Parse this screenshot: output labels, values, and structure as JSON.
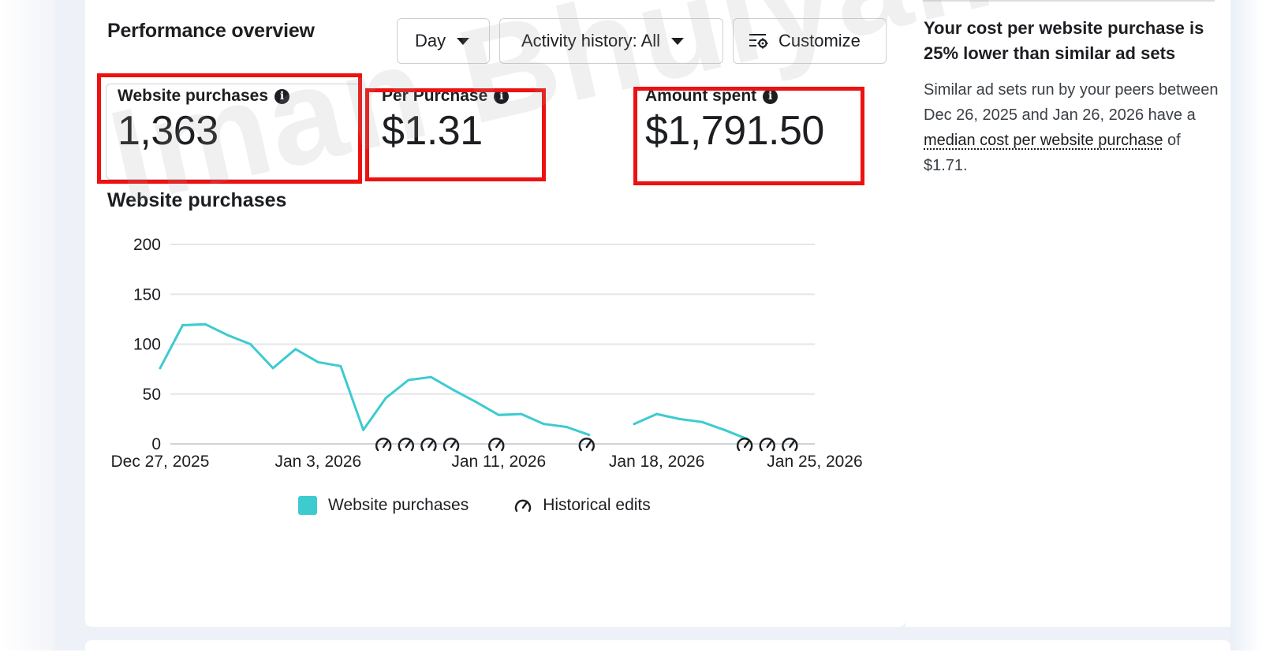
{
  "header": {
    "title": "Performance overview",
    "period_button": "Day",
    "activity_button": "Activity history: All",
    "customize_button": "Customize"
  },
  "metrics": [
    {
      "label": "Website purchases",
      "value": "1,363"
    },
    {
      "label": "Per Purchase",
      "value": "$1.31"
    },
    {
      "label": "Amount spent",
      "value": "$1,791.50"
    }
  ],
  "chart_title": "Website purchases",
  "chart_data": {
    "type": "line",
    "series": [
      {
        "name": "Website purchases",
        "color": "#3dcbd0"
      }
    ],
    "x_tick_labels": [
      "Dec 27, 2025",
      "Jan 3, 2026",
      "Jan 11, 2026",
      "Jan 18, 2026",
      "Jan 25, 2026"
    ],
    "x_tick_positions": [
      0,
      7,
      15,
      22,
      29
    ],
    "y_ticks": [
      0,
      50,
      100,
      150,
      200
    ],
    "ylim": [
      0,
      200
    ],
    "xlim": [
      -2.2,
      29.0
    ],
    "points": [
      {
        "day": 0,
        "value": 76
      },
      {
        "day": 1,
        "value": 119
      },
      {
        "day": 2,
        "value": 120
      },
      {
        "day": 3,
        "value": 109
      },
      {
        "day": 4,
        "value": 100
      },
      {
        "day": 5,
        "value": 76
      },
      {
        "day": 6,
        "value": 95
      },
      {
        "day": 7,
        "value": 82
      },
      {
        "day": 8,
        "value": 78
      },
      {
        "day": 9,
        "value": 14
      },
      {
        "day": 10,
        "value": 46
      },
      {
        "day": 11,
        "value": 64
      },
      {
        "day": 12,
        "value": 67
      },
      {
        "day": 13,
        "value": 54
      },
      {
        "day": 14,
        "value": 42
      },
      {
        "day": 15,
        "value": 29
      },
      {
        "day": 16,
        "value": 30
      },
      {
        "day": 17,
        "value": 20
      },
      {
        "day": 18,
        "value": 17
      },
      {
        "day": 19,
        "value": 9
      },
      {
        "day": 21,
        "value": 20
      },
      {
        "day": 22,
        "value": 30
      },
      {
        "day": 23,
        "value": 25
      },
      {
        "day": 24,
        "value": 22
      },
      {
        "day": 25,
        "value": 14
      },
      {
        "day": 26,
        "value": 5
      }
    ],
    "historical_edit_days": [
      10,
      11,
      12,
      13,
      15,
      19,
      26,
      27,
      28
    ],
    "grid": true
  },
  "legend": {
    "series_label": "Website purchases",
    "edits_label": "Historical edits"
  },
  "side": {
    "heading": "Your cost per website purchase is 25% lower than similar ad sets",
    "body_before": "Similar ad sets run by your peers between Dec 26, 2025 and Jan 26, 2026 have a ",
    "link": "median cost per website purchase",
    "body_after": " of $1.71."
  },
  "watermark": "Iman Bhuiyan"
}
